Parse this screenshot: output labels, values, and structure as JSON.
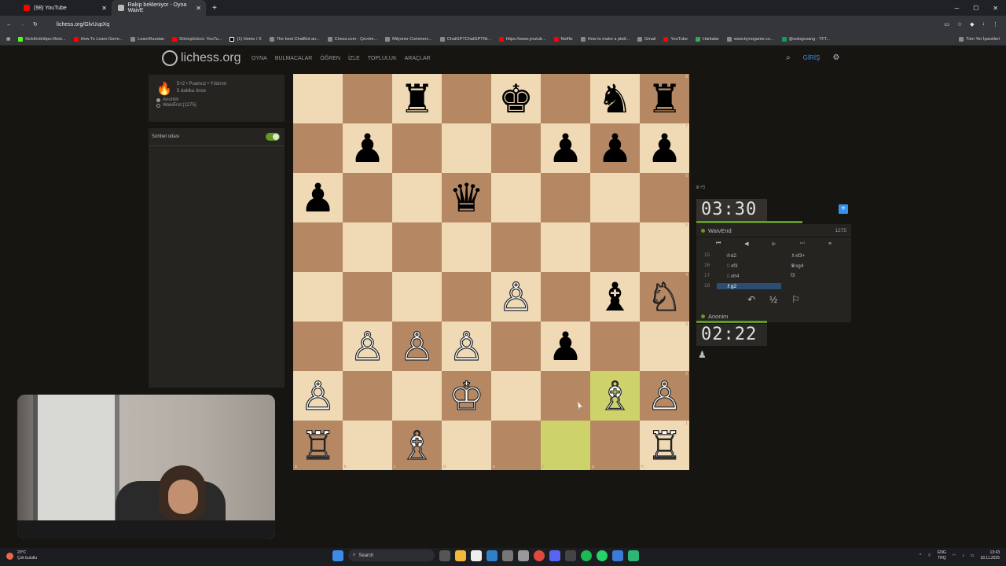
{
  "browser": {
    "tabs": [
      {
        "title": "(98) YouTube",
        "color": "#ff0000"
      },
      {
        "title": "Rakip bekleniyor - Oyna WaivE",
        "color": "#bababa"
      }
    ],
    "url": "lichess.org/GlvUupXq",
    "bookmarks": [
      "KickKickhttps://kick...",
      "How To Learn Germ...",
      "LearnRussian",
      "Dönüştürücü: YouTu...",
      "(1) Home / X",
      "The best ChatBot an...",
      "Chess.com - Çevrim...",
      "Milyoner Commerc...",
      "ChatGPTChatGPTNt...",
      "https://www.youtub...",
      "Netflix",
      "How to make a platf...",
      "Gmail",
      "YouTube",
      "Haritalar",
      "www.bynogame.co...",
      "@sologesang - TFT..."
    ],
    "bookmarks_right": "Tüm Yer İşaretleri"
  },
  "site": {
    "logo": "lichess.org",
    "nav": [
      "OYNA",
      "BULMACALAR",
      "ÖĞREN",
      "İZLE",
      "TOPLULUK",
      "ARAÇLAR"
    ],
    "login": "GİRİŞ"
  },
  "game_info": {
    "mode": "5+2 • Puansız • Yıldırım",
    "time_ago": "5 dakika önce",
    "player1": "Anonim",
    "player2": "WaivEnd (1275)"
  },
  "chat": {
    "label": "Sohbet odası"
  },
  "board": {
    "rows": [
      [
        "",
        "",
        "♜",
        "",
        "♚",
        "",
        "♞",
        "♜"
      ],
      [
        "",
        "♟",
        "",
        "",
        "",
        "♟",
        "♟",
        "♟"
      ],
      [
        "♟",
        "",
        "",
        "♛",
        "",
        "",
        "",
        ""
      ],
      [
        "",
        "",
        "",
        "",
        "",
        "",
        "",
        ""
      ],
      [
        "",
        "",
        "",
        "",
        "♙",
        "",
        "♝",
        "♘"
      ],
      [
        "",
        "♙",
        "♙",
        "♙",
        "",
        "♟",
        "",
        ""
      ],
      [
        "♙",
        "",
        "",
        "♔",
        "",
        "",
        "♗",
        "♙"
      ],
      [
        "♖",
        "",
        "♗",
        "",
        "",
        "",
        "",
        "♖"
      ]
    ],
    "colors": [
      [
        "",
        "",
        "b",
        "",
        "b",
        "",
        "b",
        "b"
      ],
      [
        "",
        "b",
        "",
        "",
        "",
        "b",
        "b",
        "b"
      ],
      [
        "b",
        "",
        "",
        "b",
        "",
        "",
        "",
        ""
      ],
      [
        "",
        "",
        "",
        "",
        "",
        "",
        "",
        ""
      ],
      [
        "",
        "",
        "",
        "",
        "w",
        "",
        "b",
        "w"
      ],
      [
        "",
        "w",
        "w",
        "w",
        "",
        "b",
        "",
        ""
      ],
      [
        "w",
        "",
        "",
        "w",
        "",
        "",
        "w",
        "w"
      ],
      [
        "w",
        "",
        "w",
        "",
        "",
        "",
        "",
        "w"
      ]
    ],
    "highlights": [
      "f1",
      "g2"
    ],
    "ranks": [
      "8",
      "7",
      "6",
      "5",
      "4",
      "3",
      "2",
      "1"
    ],
    "files": [
      "a",
      "b",
      "c",
      "d",
      "e",
      "f",
      "g",
      "h"
    ]
  },
  "opponent": {
    "material": "+5",
    "clock": "03:30",
    "name": "WaivEnd",
    "rating": "1275"
  },
  "moves": [
    {
      "n": "15",
      "w": "♔d2",
      "b": "♗xf3+"
    },
    {
      "n": "16",
      "w": "♘xf3",
      "b": "♛xg4"
    },
    {
      "n": "17",
      "w": "♘xh4",
      "b": "f3"
    },
    {
      "n": "18",
      "w": "♗g2",
      "b": ""
    }
  ],
  "me": {
    "name": "Anonim",
    "clock": "02:22"
  },
  "taskbar": {
    "temp": "20°C",
    "weather": "Çok bulutlu",
    "search": "Search",
    "lang1": "ENG",
    "lang2": "TRQ",
    "time": "13:43",
    "date": "18.11.2025"
  }
}
